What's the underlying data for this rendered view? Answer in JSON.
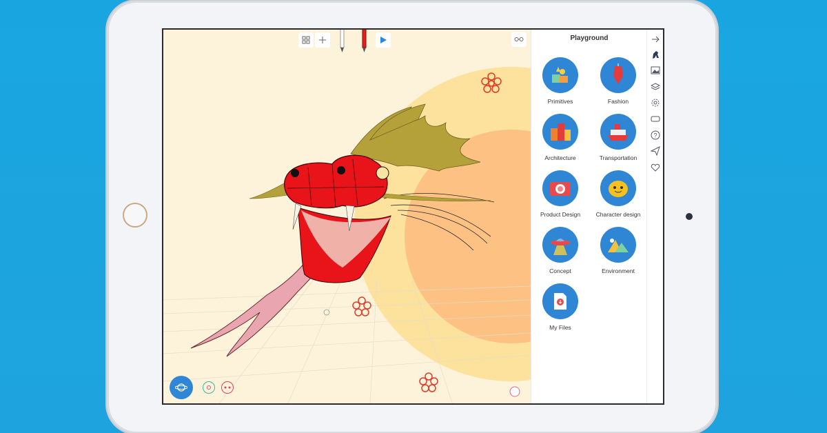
{
  "panel": {
    "title": "Playground",
    "categories": [
      {
        "label": "Primitives",
        "icon": "primitives-icon"
      },
      {
        "label": "Fashion",
        "icon": "dress-form-icon"
      },
      {
        "label": "Architecture",
        "icon": "buildings-icon"
      },
      {
        "label": "Transportation",
        "icon": "ship-icon"
      },
      {
        "label": "Product Design",
        "icon": "camera-icon"
      },
      {
        "label": "Character design",
        "icon": "character-icon"
      },
      {
        "label": "Concept",
        "icon": "ufo-icon"
      },
      {
        "label": "Environment",
        "icon": "mountains-icon"
      },
      {
        "label": "My Files",
        "icon": "file-download-icon"
      }
    ]
  },
  "toolbar": {
    "icons": [
      "grid-icon",
      "plus-icon",
      "pencil-icon",
      "red-pencil-icon",
      "play-icon",
      "glasses-icon"
    ]
  },
  "rail": {
    "icons": [
      "arrow-right-icon",
      "horse-icon",
      "image-icon",
      "layers-icon",
      "settings-icon",
      "vr-headset-icon",
      "help-icon",
      "send-icon",
      "heart-icon"
    ]
  },
  "bottom": {
    "icons": [
      "planet-icon",
      "chat-icon",
      "dots-icon",
      "face-icon"
    ]
  },
  "colors": {
    "background": "#19a6e0",
    "canvas": "#fdf3da",
    "category_circle": "#2e86d4",
    "dragon_red": "#e8141a",
    "dragon_mane": "#b5a13a",
    "sun": "#fdd58a"
  }
}
